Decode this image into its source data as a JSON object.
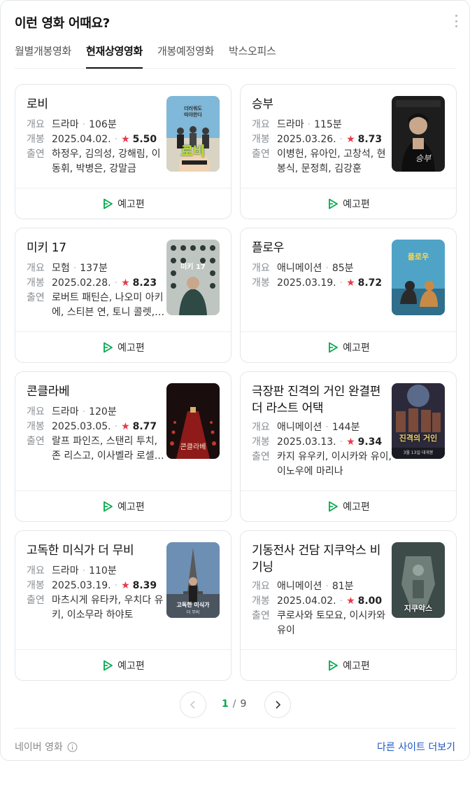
{
  "header": {
    "title": "이런 영화 어때요?"
  },
  "tabs": [
    {
      "label": "월별개봉영화",
      "active": false
    },
    {
      "label": "현재상영영화",
      "active": true
    },
    {
      "label": "개봉예정영화",
      "active": false
    },
    {
      "label": "박스오피스",
      "active": false
    }
  ],
  "labels": {
    "genre": "개요",
    "release": "개봉",
    "cast": "출연",
    "trailer": "예고편"
  },
  "movies": [
    {
      "title": "로비",
      "genre": "드라마",
      "runtime": "106분",
      "release": "2025.04.02.",
      "rating": "5.50",
      "cast": "하정우, 김의성, 강해림, 이동휘, 박병은, 강말금",
      "poster_text": "로비"
    },
    {
      "title": "승부",
      "genre": "드라마",
      "runtime": "115분",
      "release": "2025.03.26.",
      "rating": "8.73",
      "cast": "이병헌, 유아인, 고창석, 현봉식, 문정희, 김강훈",
      "poster_text": "승부"
    },
    {
      "title": "미키 17",
      "genre": "모험",
      "runtime": "137분",
      "release": "2025.02.28.",
      "rating": "8.23",
      "cast": "로버트 패틴슨, 나오미 아키에, 스티븐 연, 토니 콜렛, 마크 러팔로",
      "poster_text": "미키 17"
    },
    {
      "title": "플로우",
      "genre": "애니메이션",
      "runtime": "85분",
      "release": "2025.03.19.",
      "rating": "8.72",
      "cast": "",
      "poster_text": "플로우"
    },
    {
      "title": "콘클라베",
      "genre": "드라마",
      "runtime": "120분",
      "release": "2025.03.05.",
      "rating": "8.77",
      "cast": "랄프 파인즈, 스탠리 투치, 존 리스고, 이사벨라 로셀리니",
      "poster_text": "콘클라베"
    },
    {
      "title": "극장판 진격의 거인 완결편 더 라스트 어택",
      "genre": "애니메이션",
      "runtime": "144분",
      "release": "2025.03.13.",
      "rating": "9.34",
      "cast": "카지 유우키, 이시카와 유이, 이노우에 마리나",
      "poster_text": "진격의 거인",
      "poster_sub": "3월 13일 대개봉"
    },
    {
      "title": "고독한 미식가 더 무비",
      "genre": "드라마",
      "runtime": "110분",
      "release": "2025.03.19.",
      "rating": "8.39",
      "cast": "마츠시게 유타카, 우치다 유키, 이소무라 하야토",
      "poster_text": "고독한 미식가",
      "poster_sub": "더 무비"
    },
    {
      "title": "기동전사 건담 지쿠악스 비기닝",
      "genre": "애니메이션",
      "runtime": "81분",
      "release": "2025.04.02.",
      "rating": "8.00",
      "cast": "쿠로사와 토모요, 이시카와 유이",
      "poster_text": "지쿠악스"
    }
  ],
  "pagination": {
    "current": "1",
    "separator": "/",
    "total": "9"
  },
  "footer": {
    "source": "네이버 영화",
    "more": "다른 사이트 더보기"
  },
  "colors": {
    "accent_green": "#03a94d",
    "star_red": "#e8384b",
    "link_blue": "#1a55c4"
  }
}
